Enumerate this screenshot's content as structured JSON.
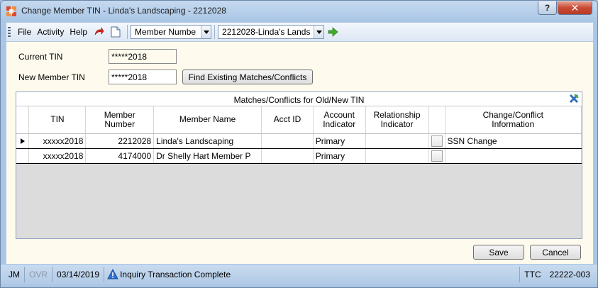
{
  "window": {
    "title": "Change Member TIN - Linda's Landscaping - 2212028",
    "help_label": "?",
    "close_label": "✕"
  },
  "toolbar": {
    "menu": [
      "File",
      "Activity",
      "Help"
    ],
    "search_type": "Member Numbe",
    "member_select": "2212028-Linda's Lands"
  },
  "form": {
    "current_tin_label": "Current TIN",
    "current_tin_value": "*****2018",
    "new_tin_label": "New Member TIN",
    "new_tin_value": "*****2018",
    "find_button": "Find Existing Matches/Conflicts"
  },
  "grid": {
    "caption": "Matches/Conflicts for Old/New TIN",
    "columns": [
      [
        "TIN"
      ],
      [
        "Member",
        "Number"
      ],
      [
        "Member Name"
      ],
      [
        "Acct ID"
      ],
      [
        "Account",
        "Indicator"
      ],
      [
        "Relationship",
        "Indicator"
      ],
      [
        ""
      ],
      [
        "Change/Conflict",
        "Information"
      ]
    ],
    "rows": [
      {
        "tin": "xxxxx2018",
        "member_number": "2212028",
        "member_name": "Linda's Landscaping",
        "acct_id": "",
        "account_indicator": "Primary",
        "relationship_indicator": "",
        "change_info": "SSN Change",
        "selected": true
      },
      {
        "tin": "xxxxx2018",
        "member_number": "4174000",
        "member_name": "Dr Shelly Hart Member P",
        "acct_id": "",
        "account_indicator": "Primary",
        "relationship_indicator": "",
        "change_info": "",
        "selected": false
      }
    ]
  },
  "buttons": {
    "save": "Save",
    "cancel": "Cancel"
  },
  "status": {
    "user": "JM",
    "ovr": "OVR",
    "date": "03/14/2019",
    "message": "Inquiry Transaction Complete",
    "ttc_label": "TTC",
    "ttc_value": "22222-003"
  },
  "colors": {
    "content_bg": "#fefbee",
    "frame_blue": "#a9c6e6",
    "close_red": "#c94a33"
  }
}
